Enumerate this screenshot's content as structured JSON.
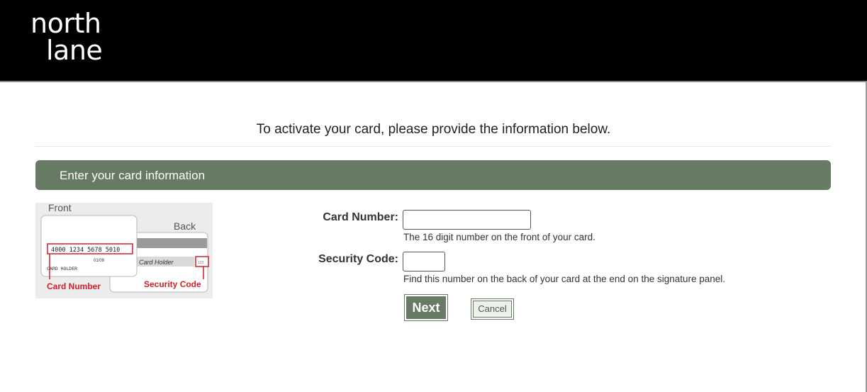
{
  "brand": {
    "line1": "north",
    "line2": "lane"
  },
  "intro_text": "To activate your card, please provide the information below.",
  "section": {
    "title": "Enter your card information"
  },
  "card_image": {
    "front_label": "Front",
    "back_label": "Back",
    "card_number_sample": "4000 1234 5678 5010",
    "expiry_sample": "01/09",
    "holder_front": "CARD HOLDER",
    "holder_back": "Card Holder",
    "cvv_sample": "123",
    "card_number_caption": "Card Number",
    "security_code_caption": "Security Code"
  },
  "form": {
    "card_number": {
      "label": "Card Number:",
      "value": "",
      "hint": "The 16 digit number on the front of your card."
    },
    "security_code": {
      "label": "Security Code:",
      "value": "",
      "hint": "Find this number on the back of your card at the end on the signature panel."
    },
    "next_label": "Next",
    "cancel_label": "Cancel"
  },
  "colors": {
    "header_bg": "#000000",
    "accent_green": "#677a64",
    "highlight_red": "#d0202a"
  }
}
